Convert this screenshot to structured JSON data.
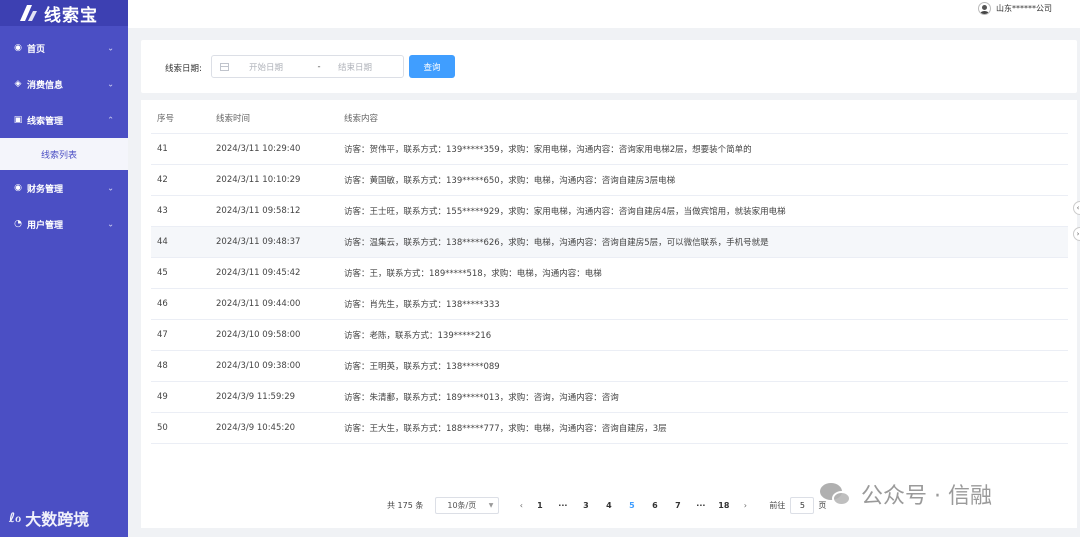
{
  "app": {
    "logo_text": "线索宝"
  },
  "sidebar": {
    "items": [
      {
        "label": "首页",
        "icon": "home-icon",
        "glyph": "◉",
        "chevron": "⌄"
      },
      {
        "label": "消费信息",
        "icon": "tag-icon",
        "glyph": "◈",
        "chevron": "⌄"
      },
      {
        "label": "线索管理",
        "icon": "monitor-icon",
        "glyph": "▣",
        "chevron": "⌃"
      },
      {
        "label": "财务管理",
        "icon": "finance-icon",
        "glyph": "◉",
        "chevron": "⌄"
      },
      {
        "label": "用户管理",
        "icon": "user-settings-icon",
        "glyph": "◔",
        "chevron": "⌄"
      }
    ],
    "sub_item": "线索列表"
  },
  "header": {
    "user_name": "山东******公司"
  },
  "filter": {
    "label": "线索日期:",
    "start_placeholder": "开始日期",
    "separator": "-",
    "end_placeholder": "结束日期",
    "query_label": "查询"
  },
  "table": {
    "columns": [
      "序号",
      "线索时间",
      "线索内容"
    ],
    "rows": [
      {
        "no": "41",
        "time": "2024/3/11 10:29:40",
        "content": "访客：贺伟平，联系方式：139*****359，求购：家用电梯，沟通内容：咨询家用电梯2层，想要装个简单的"
      },
      {
        "no": "42",
        "time": "2024/3/11 10:10:29",
        "content": "访客：黄国敏，联系方式：139*****650，求购：电梯，沟通内容：咨询自建房3层电梯"
      },
      {
        "no": "43",
        "time": "2024/3/11 09:58:12",
        "content": "访客：王士旺，联系方式：155*****929，求购：家用电梯，沟通内容：咨询自建房4层，当做宾馆用，就装家用电梯"
      },
      {
        "no": "44",
        "time": "2024/3/11 09:48:37",
        "content": "访客：温集云，联系方式：138*****626，求购：电梯，沟通内容：咨询自建房5层，可以微信联系，手机号就是"
      },
      {
        "no": "45",
        "time": "2024/3/11 09:45:42",
        "content": "访客：王，联系方式：189*****518，求购：电梯，沟通内容：电梯"
      },
      {
        "no": "46",
        "time": "2024/3/11 09:44:00",
        "content": "访客：肖先生，联系方式：138*****333"
      },
      {
        "no": "47",
        "time": "2024/3/10 09:58:00",
        "content": "访客：老陈，联系方式：139*****216"
      },
      {
        "no": "48",
        "time": "2024/3/10 09:38:00",
        "content": "访客：王明英，联系方式：138*****089"
      },
      {
        "no": "49",
        "time": "2024/3/9 11:59:29",
        "content": "访客：朱清鄱，联系方式：189*****013，求购：咨询，沟通内容：咨询"
      },
      {
        "no": "50",
        "time": "2024/3/9 10:45:20",
        "content": "访客：王大生，联系方式：188*****777，求购：电梯，沟通内容：咨询自建房，3层"
      }
    ]
  },
  "pagination": {
    "total": "共 175 条",
    "page_size": "10条/页",
    "prev": "‹",
    "pages": [
      "1",
      "···",
      "3",
      "4",
      "5",
      "6",
      "7",
      "···",
      "18"
    ],
    "active_page": "5",
    "next": "›",
    "goto_label": "前往",
    "goto_value": "5",
    "page_unit": "页"
  },
  "watermarks": {
    "left": "大数跨境",
    "left_mark": "ℓℴ",
    "right": "公众号 · 信融"
  },
  "colors": {
    "sidebar": "#4b4fc4",
    "accent": "#409eff"
  }
}
